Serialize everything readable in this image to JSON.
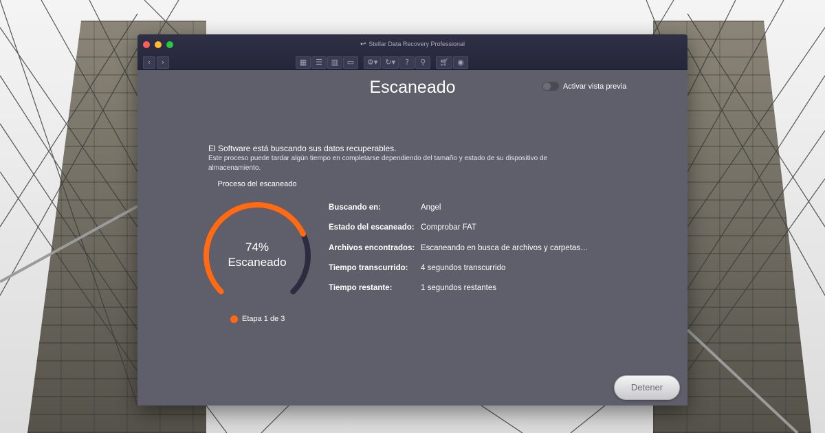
{
  "window": {
    "title": "Stellar Data Recovery Professional",
    "title_icon": "refresh-back-icon"
  },
  "nav": {
    "back_icon": "chevron-left-icon",
    "forward_icon": "chevron-right-icon"
  },
  "toolbar": {
    "view_icons": [
      "grid-view-icon",
      "list-view-icon",
      "column-view-icon",
      "coverflow-view-icon"
    ],
    "settings_icon": "gear-icon",
    "history_icon": "history-icon",
    "help_icon": "question-icon",
    "tools_icon": "microscope-icon",
    "cart_icon": "cart-icon",
    "account_icon": "user-icon"
  },
  "main": {
    "title": "Escaneado",
    "preview_toggle_label": "Activar vista previa",
    "preview_enabled": false,
    "message_title": "El Software está buscando sus datos recuperables.",
    "message_desc": "Este proceso puede tardar algún tiempo en completarse dependiendo del tamaño y estado de su dispositivo de almacenamiento."
  },
  "progress": {
    "label": "Proceso del escaneado",
    "percent": 74,
    "percent_text": "74%",
    "status": "Escaneado",
    "stage": "Etapa 1 de 3"
  },
  "info": [
    {
      "key": "Buscando en:",
      "value": "Angel"
    },
    {
      "key": "Estado del escaneado:",
      "value": "Comprobar FAT"
    },
    {
      "key": "Archivos encontrados:",
      "value": "Escaneando en busca de archivos y carpetas…"
    },
    {
      "key": "Tiempo transcurrido:",
      "value": "4 segundos transcurrido"
    },
    {
      "key": "Tiempo restante:",
      "value": "1 segundos restantes"
    }
  ],
  "actions": {
    "stop_label": "Detener"
  },
  "colors": {
    "accent": "#ff6a13",
    "gauge_track": "#2b2c40",
    "window_bg": "#5f5e6b",
    "titlebar_bg": "#2a2b40"
  }
}
